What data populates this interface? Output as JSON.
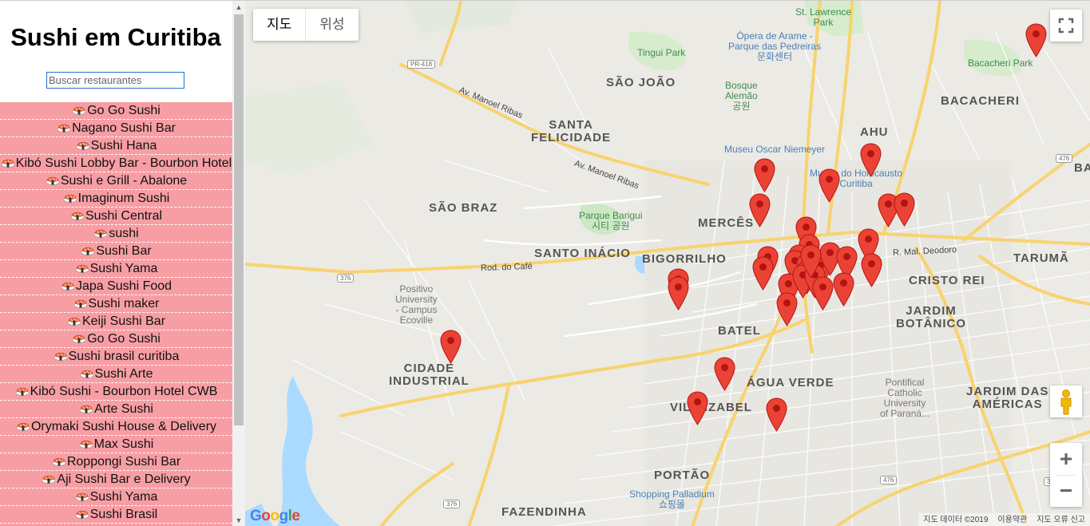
{
  "sidebar": {
    "title": "Sushi em Curitiba",
    "search_placeholder": "Buscar restaurantes",
    "search_value": "",
    "items": [
      {
        "label": "Go Go Sushi"
      },
      {
        "label": "Nagano Sushi Bar"
      },
      {
        "label": "Sushi Hana"
      },
      {
        "label": "Kibó Sushi Lobby Bar - Bourbon Hotel"
      },
      {
        "label": "Sushi e Grill - Abalone"
      },
      {
        "label": "Imaginum Sushi"
      },
      {
        "label": "Sushi Central"
      },
      {
        "label": "sushi"
      },
      {
        "label": "Sushi Bar"
      },
      {
        "label": "Sushi Yama"
      },
      {
        "label": "Japa Sushi Food"
      },
      {
        "label": "Sushi maker"
      },
      {
        "label": "Keiji Sushi Bar"
      },
      {
        "label": "Go Go Sushi"
      },
      {
        "label": "Sushi brasil curitiba"
      },
      {
        "label": "Sushi Arte"
      },
      {
        "label": "Kibó Sushi - Bourbon Hotel CWB"
      },
      {
        "label": "Arte Sushi"
      },
      {
        "label": "Orymaki Sushi House & Delivery"
      },
      {
        "label": "Max Sushi"
      },
      {
        "label": "Roppongi Sushi Bar"
      },
      {
        "label": "Aji Sushi Bar e Delivery"
      },
      {
        "label": "Sushi Yama"
      },
      {
        "label": "Sushi Brasil"
      }
    ],
    "list_color": "#f79ea4"
  },
  "map": {
    "map_type_buttons": [
      "지도",
      "위성"
    ],
    "selected_map_type": "지도",
    "districts": [
      {
        "text": "SANTA\nFELICIDADE"
      },
      {
        "text": "SÃO BRAZ"
      },
      {
        "text": "MERCÊS"
      },
      {
        "text": "BIGORRILHO"
      },
      {
        "text": "CIDADE\nINDUSTRIAL"
      },
      {
        "text": "BATEL"
      },
      {
        "text": "ÁGUA VERDE"
      },
      {
        "text": "VILA IZABEL"
      },
      {
        "text": "PORTÃO"
      },
      {
        "text": "FAZENDINHA"
      },
      {
        "text": "CRISTO REI"
      },
      {
        "text": "JARDIM\nBOTÂNICO"
      },
      {
        "text": "JARDIM DAS\nAMÉRICAS"
      },
      {
        "text": "AHU"
      },
      {
        "text": "BACACHERI"
      },
      {
        "text": "SÃO JOÃO"
      },
      {
        "text": "SANTO INÁCIO"
      },
      {
        "text": "TARUMÃ"
      },
      {
        "text": "BA"
      }
    ],
    "pois": [
      {
        "text": "St. Lawrence\nPark",
        "kind": "green"
      },
      {
        "text": "Ópera de Arame -\nParque das Pedreiras\n문화센터",
        "kind": "blue"
      },
      {
        "text": "Tingui Park",
        "kind": "green"
      },
      {
        "text": "Bosque\nAlemão\n공원",
        "kind": "green"
      },
      {
        "text": "Bacacheri Park",
        "kind": "green"
      },
      {
        "text": "Museu Oscar Niemeyer",
        "kind": "blue"
      },
      {
        "text": "Museu do Holocausto\nCuritiba",
        "kind": "blue"
      },
      {
        "text": "Parque Barigui\n시티 공원",
        "kind": "green"
      },
      {
        "text": "Positivo\nUniversity\n- Campus\nEcoville",
        "kind": "gray"
      },
      {
        "text": "Pontifical\nCatholic\nUniversity\nof Paraná...",
        "kind": "gray"
      },
      {
        "text": "Shopping Palladium\n쇼핑몰",
        "kind": "blue"
      }
    ],
    "roads": [
      {
        "text": "Av. Manoel Ribas"
      },
      {
        "text": "Av. Manoel Ribas"
      },
      {
        "text": "Rod. do Café"
      },
      {
        "text": "PR-418"
      },
      {
        "text": "R. Mal. Deodoro"
      },
      {
        "text": "376"
      },
      {
        "text": "376"
      },
      {
        "text": "376"
      },
      {
        "text": "476"
      },
      {
        "text": "476"
      }
    ],
    "marker_color": "#ea4335",
    "marker_count": 33,
    "footer": [
      "지도 데이터 ©2019",
      "이용약관",
      "지도 오류 신고"
    ],
    "google_logo": "Google"
  },
  "icons": {
    "list_item_icon": "sushi-icon",
    "fullscreen": "fullscreen-icon",
    "pegman": "pegman-icon",
    "zoom_in": "+",
    "zoom_out": "−"
  }
}
